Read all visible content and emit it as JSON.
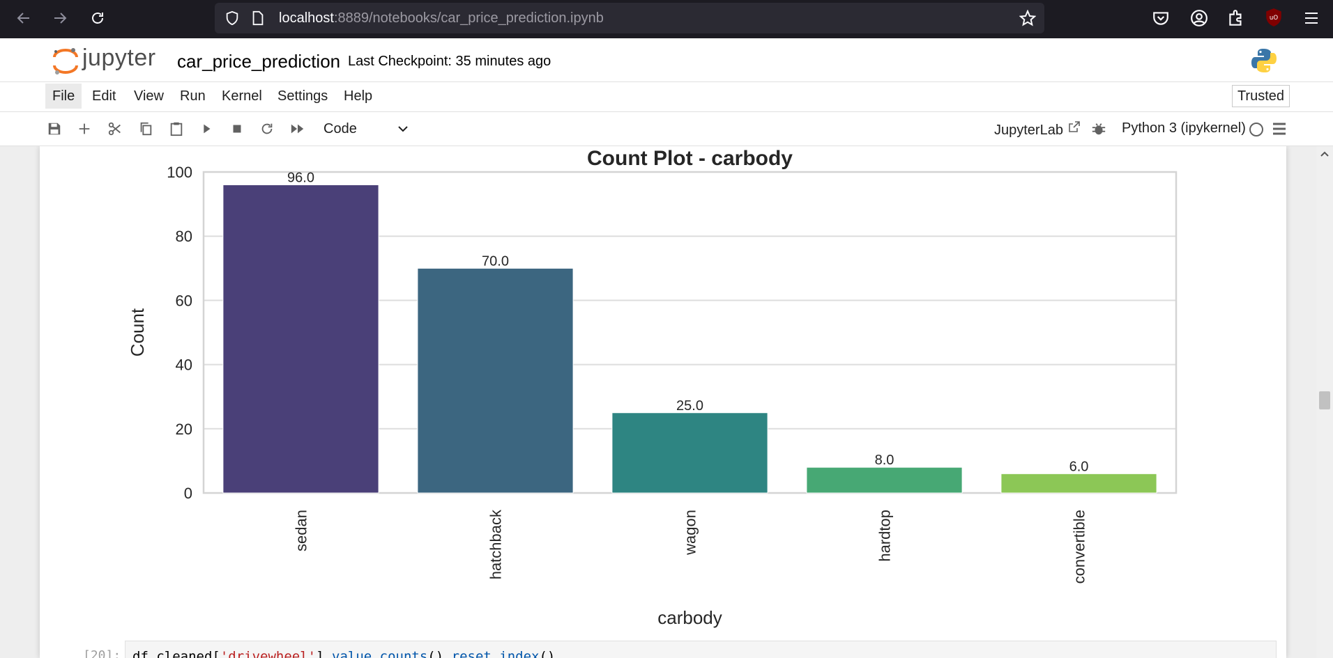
{
  "browser": {
    "url_host": "localhost",
    "url_path": ":8889/notebooks/car_price_prediction.ipynb"
  },
  "header": {
    "logo_text": "jupyter",
    "notebook_title": "car_price_prediction",
    "checkpoint": "Last Checkpoint: 35 minutes ago"
  },
  "menu": {
    "items": [
      "File",
      "Edit",
      "View",
      "Run",
      "Kernel",
      "Settings",
      "Help"
    ],
    "trusted": "Trusted"
  },
  "toolbar": {
    "cell_type": "Code",
    "jupyterlab_link": "JupyterLab",
    "kernel": "Python 3 (ipykernel)"
  },
  "chart_data": {
    "type": "bar",
    "title": "Count Plot - carbody",
    "xlabel": "carbody",
    "ylabel": "Count",
    "categories": [
      "sedan",
      "hatchback",
      "wagon",
      "hardtop",
      "convertible"
    ],
    "values": [
      96,
      70,
      25,
      8,
      6
    ],
    "value_labels": [
      "96.0",
      "70.0",
      "25.0",
      "8.0",
      "6.0"
    ],
    "ylim": [
      0,
      100
    ],
    "yticks": [
      "0",
      "20",
      "40",
      "60",
      "80",
      "100"
    ],
    "colors": [
      "#4a4078",
      "#3c6680",
      "#2e8582",
      "#47a874",
      "#8cc756"
    ],
    "grid": true
  },
  "code_cell": {
    "prompt": "[20]:",
    "code_prefix": "df_cleaned[",
    "code_string": "'drivewheel'",
    "code_mid": "].",
    "code_method1": "value_counts",
    "code_mid2": "().",
    "code_method2": "reset_index",
    "code_suffix": "()"
  }
}
